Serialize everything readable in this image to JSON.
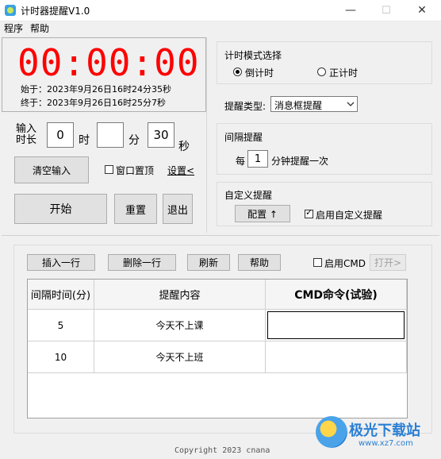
{
  "window": {
    "title": "计时器提醒V1.0",
    "minimize_glyph": "—",
    "maximize_glyph": "☐",
    "close_glyph": "✕"
  },
  "menu": {
    "items": [
      "程序",
      "帮助"
    ]
  },
  "timer": {
    "display": "00:00:00",
    "start_time": "始于：2023年9月26日16时24分35秒",
    "end_time": "终于：2023年9月26日16时25分7秒",
    "color": "#ff0000"
  },
  "input": {
    "label": "输入\n时长",
    "hours_value": "0",
    "hours_unit": "时",
    "minutes_value": "",
    "minutes_unit": "分",
    "seconds_value": "30",
    "seconds_unit": "秒"
  },
  "buttons": {
    "clear": "清空输入",
    "start": "开始",
    "reset": "重置",
    "exit": "退出",
    "config": "配置 ↑",
    "insert_row": "插入一行",
    "delete_row": "删除一行",
    "refresh": "刷新",
    "help": "帮助",
    "open": "打开>"
  },
  "options": {
    "always_on_top": "窗口置顶",
    "settings_link": "设置<"
  },
  "mode": {
    "title": "计时模式选择",
    "countdown": "倒计时",
    "countup": "正计时",
    "selected": "countdown"
  },
  "reminder": {
    "type_label": "提醒类型:",
    "type_value": "消息框提醒"
  },
  "interval": {
    "title": "间隔提醒",
    "prefix": "每",
    "value": "1",
    "suffix": "分钟提醒一次"
  },
  "custom": {
    "title": "自定义提醒",
    "enable_label": "启用自定义提醒",
    "enabled": true
  },
  "cmd": {
    "enable_label": "启用CMD",
    "enabled": false
  },
  "table": {
    "headers": [
      "间隔时间(分)",
      "提醒内容",
      "CMD命令(试验)"
    ],
    "rows": [
      [
        "5",
        "今天不上课",
        ""
      ],
      [
        "10",
        "今天不上班",
        ""
      ]
    ]
  },
  "footer": {
    "copyright": "Copyright 2023 cnana"
  },
  "watermark": {
    "text": "极光下载站",
    "url": "www.xz7.com"
  }
}
